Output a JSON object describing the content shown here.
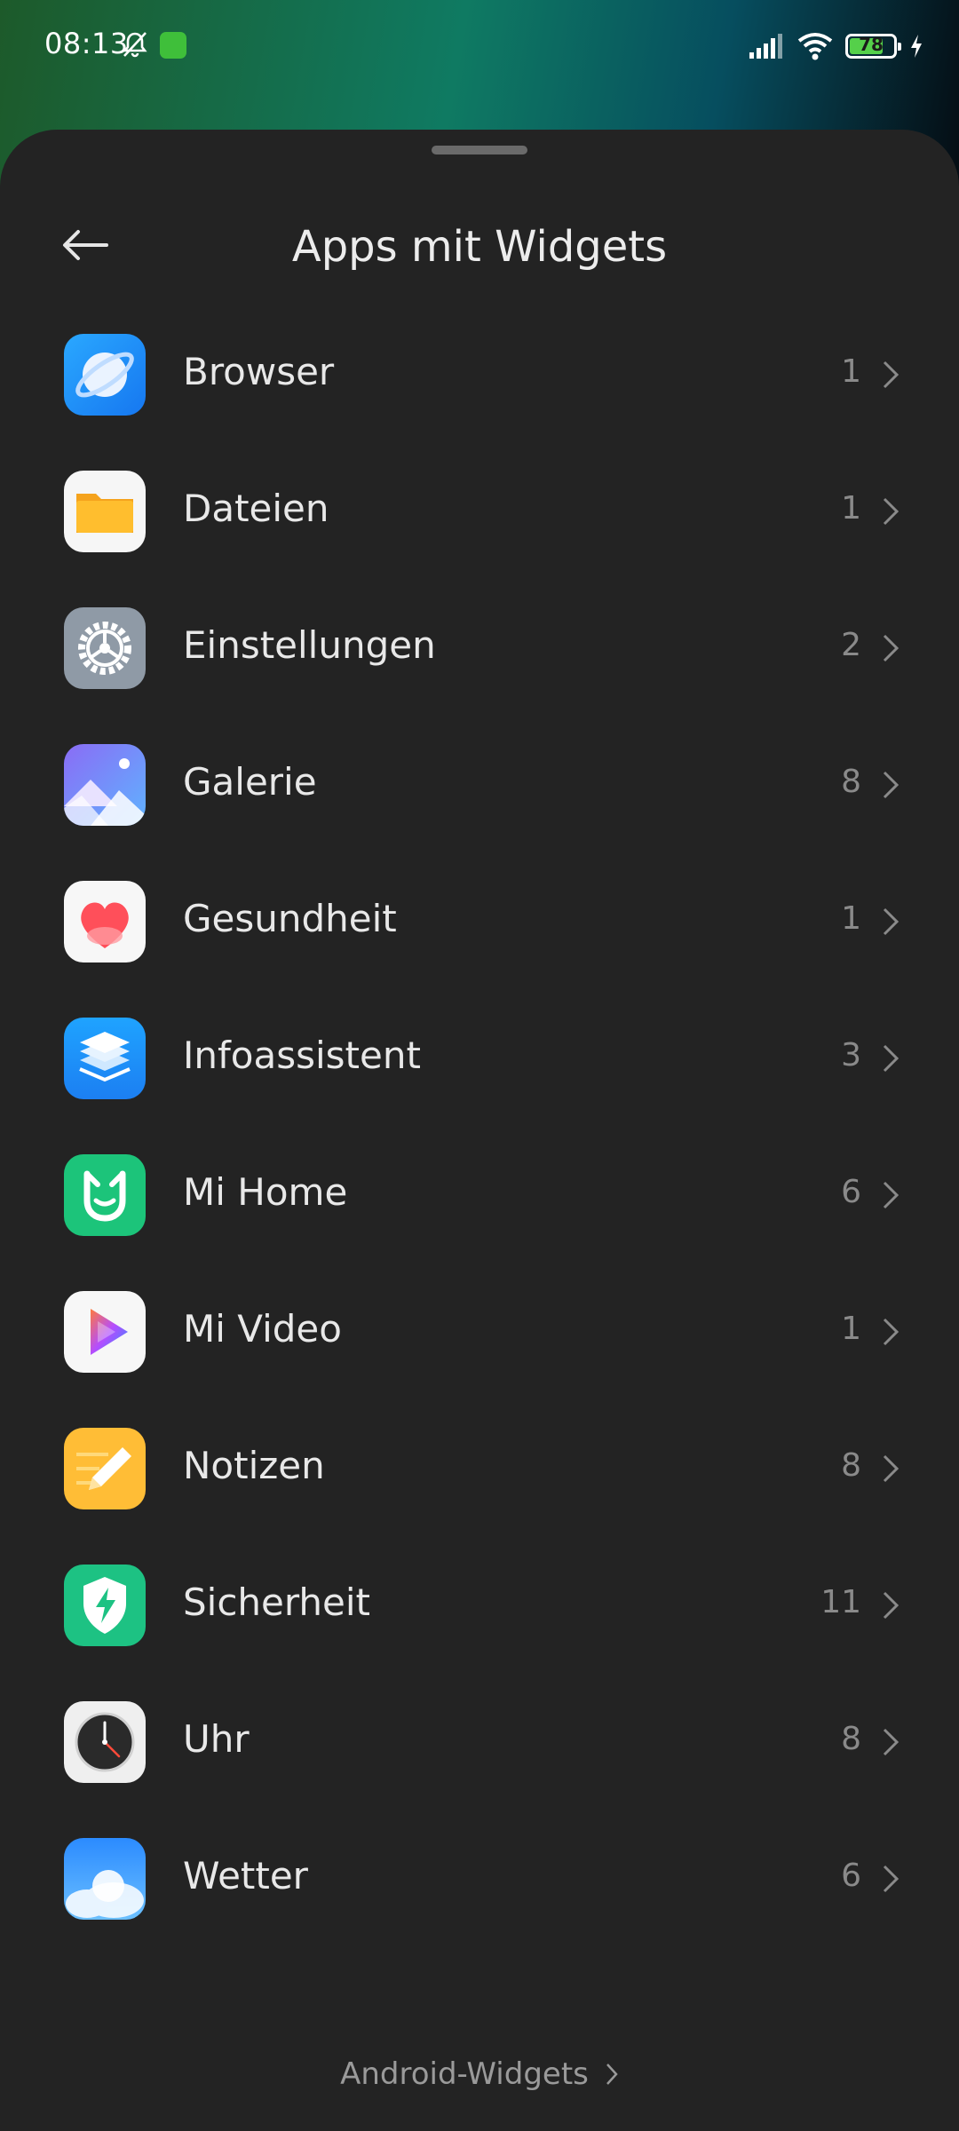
{
  "status_bar": {
    "time": "08:13",
    "battery": "78",
    "battery_level_percent": 78
  },
  "header": {
    "title": "Apps mit Widgets"
  },
  "apps": [
    {
      "name": "Browser",
      "count": "1",
      "icon": "browser-icon"
    },
    {
      "name": "Dateien",
      "count": "1",
      "icon": "folder-icon"
    },
    {
      "name": "Einstellungen",
      "count": "2",
      "icon": "settings-gear-icon"
    },
    {
      "name": "Galerie",
      "count": "8",
      "icon": "gallery-icon"
    },
    {
      "name": "Gesundheit",
      "count": "1",
      "icon": "heart-icon"
    },
    {
      "name": "Infoassistent",
      "count": "3",
      "icon": "layers-icon"
    },
    {
      "name": "Mi Home",
      "count": "6",
      "icon": "mi-home-icon"
    },
    {
      "name": "Mi Video",
      "count": "1",
      "icon": "play-icon"
    },
    {
      "name": "Notizen",
      "count": "8",
      "icon": "notes-pencil-icon"
    },
    {
      "name": "Sicherheit",
      "count": "11",
      "icon": "shield-bolt-icon"
    },
    {
      "name": "Uhr",
      "count": "8",
      "icon": "clock-icon"
    },
    {
      "name": "Wetter",
      "count": "6",
      "icon": "cloud-icon"
    }
  ],
  "footer": {
    "link": "Android-Widgets"
  }
}
